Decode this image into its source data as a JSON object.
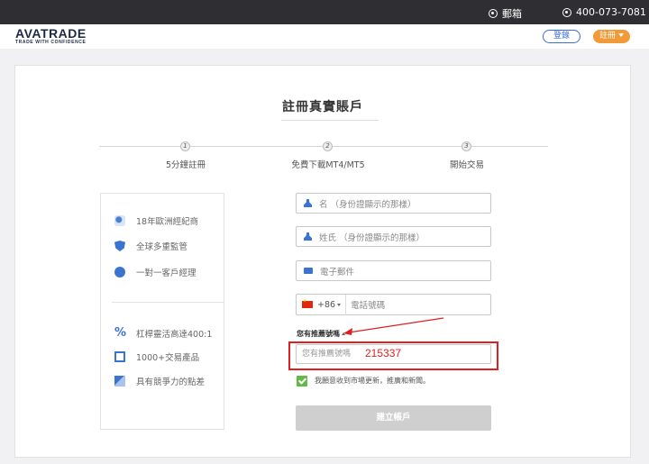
{
  "topbar": {
    "mail_label": "郵箱",
    "phone_number": "400-073-7081"
  },
  "header": {
    "logo_text": "AVATRADE",
    "logo_tagline": "TRADE WITH CONFIDENCE",
    "login_label": "登錄",
    "register_label": "註冊"
  },
  "page": {
    "title": "註冊真實賬戶"
  },
  "steps": [
    {
      "num": "1",
      "label": "5分鐘註冊"
    },
    {
      "num": "2",
      "label": "免費下載MT4/MT5"
    },
    {
      "num": "3",
      "label": "開始交易"
    }
  ],
  "features": {
    "group1": [
      "18年歐洲經紀商",
      "全球多重監管",
      "一對一客戶經理"
    ],
    "group2": [
      "杠桿靈活高達400:1",
      "1000+交易產品",
      "具有競爭力的點差"
    ]
  },
  "form": {
    "first_name_placeholder": "名 （身份證顯示的那樣）",
    "last_name_placeholder": "姓氏 （身份證顯示的那樣）",
    "email_placeholder": "電子郵件",
    "country_code": "+86",
    "phone_placeholder": "電話號碼",
    "referral_toggle_label": "您有推薦號嗎",
    "referral_placeholder": "您有推薦號嗎",
    "referral_annotation": "215337",
    "consent_label": "我願意收到市場更新，推廣和新聞。",
    "submit_label": "建立帳戶"
  }
}
